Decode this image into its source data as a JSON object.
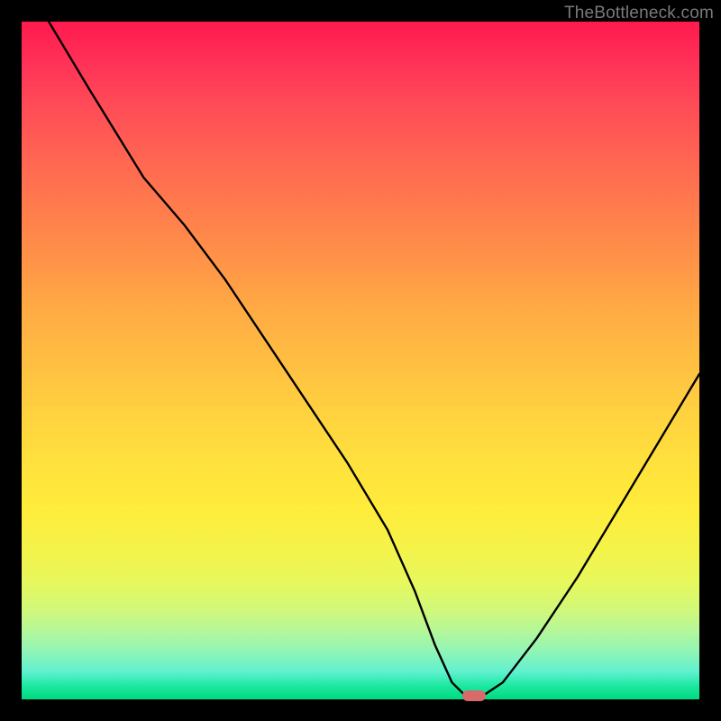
{
  "watermark": "TheBottleneck.com",
  "chart_data": {
    "type": "line",
    "title": "",
    "xlabel": "",
    "ylabel": "",
    "xlim": [
      0,
      100
    ],
    "ylim": [
      0,
      100
    ],
    "grid": false,
    "series": [
      {
        "name": "bottleneck-curve",
        "x": [
          4,
          10,
          18,
          24,
          30,
          36,
          42,
          48,
          54,
          58,
          61,
          63.5,
          65.5,
          68,
          71,
          76,
          82,
          88,
          94,
          100
        ],
        "y": [
          100,
          90,
          77,
          70,
          62,
          53,
          44,
          35,
          25,
          16,
          8,
          2.5,
          0.5,
          0.5,
          2.5,
          9,
          18,
          28,
          38,
          48
        ]
      }
    ],
    "marker": {
      "x": 66.8,
      "y": 0.5,
      "color": "#d86a6a"
    },
    "gradient_note": "background encodes bottleneck severity: red=high, green=ideal"
  }
}
